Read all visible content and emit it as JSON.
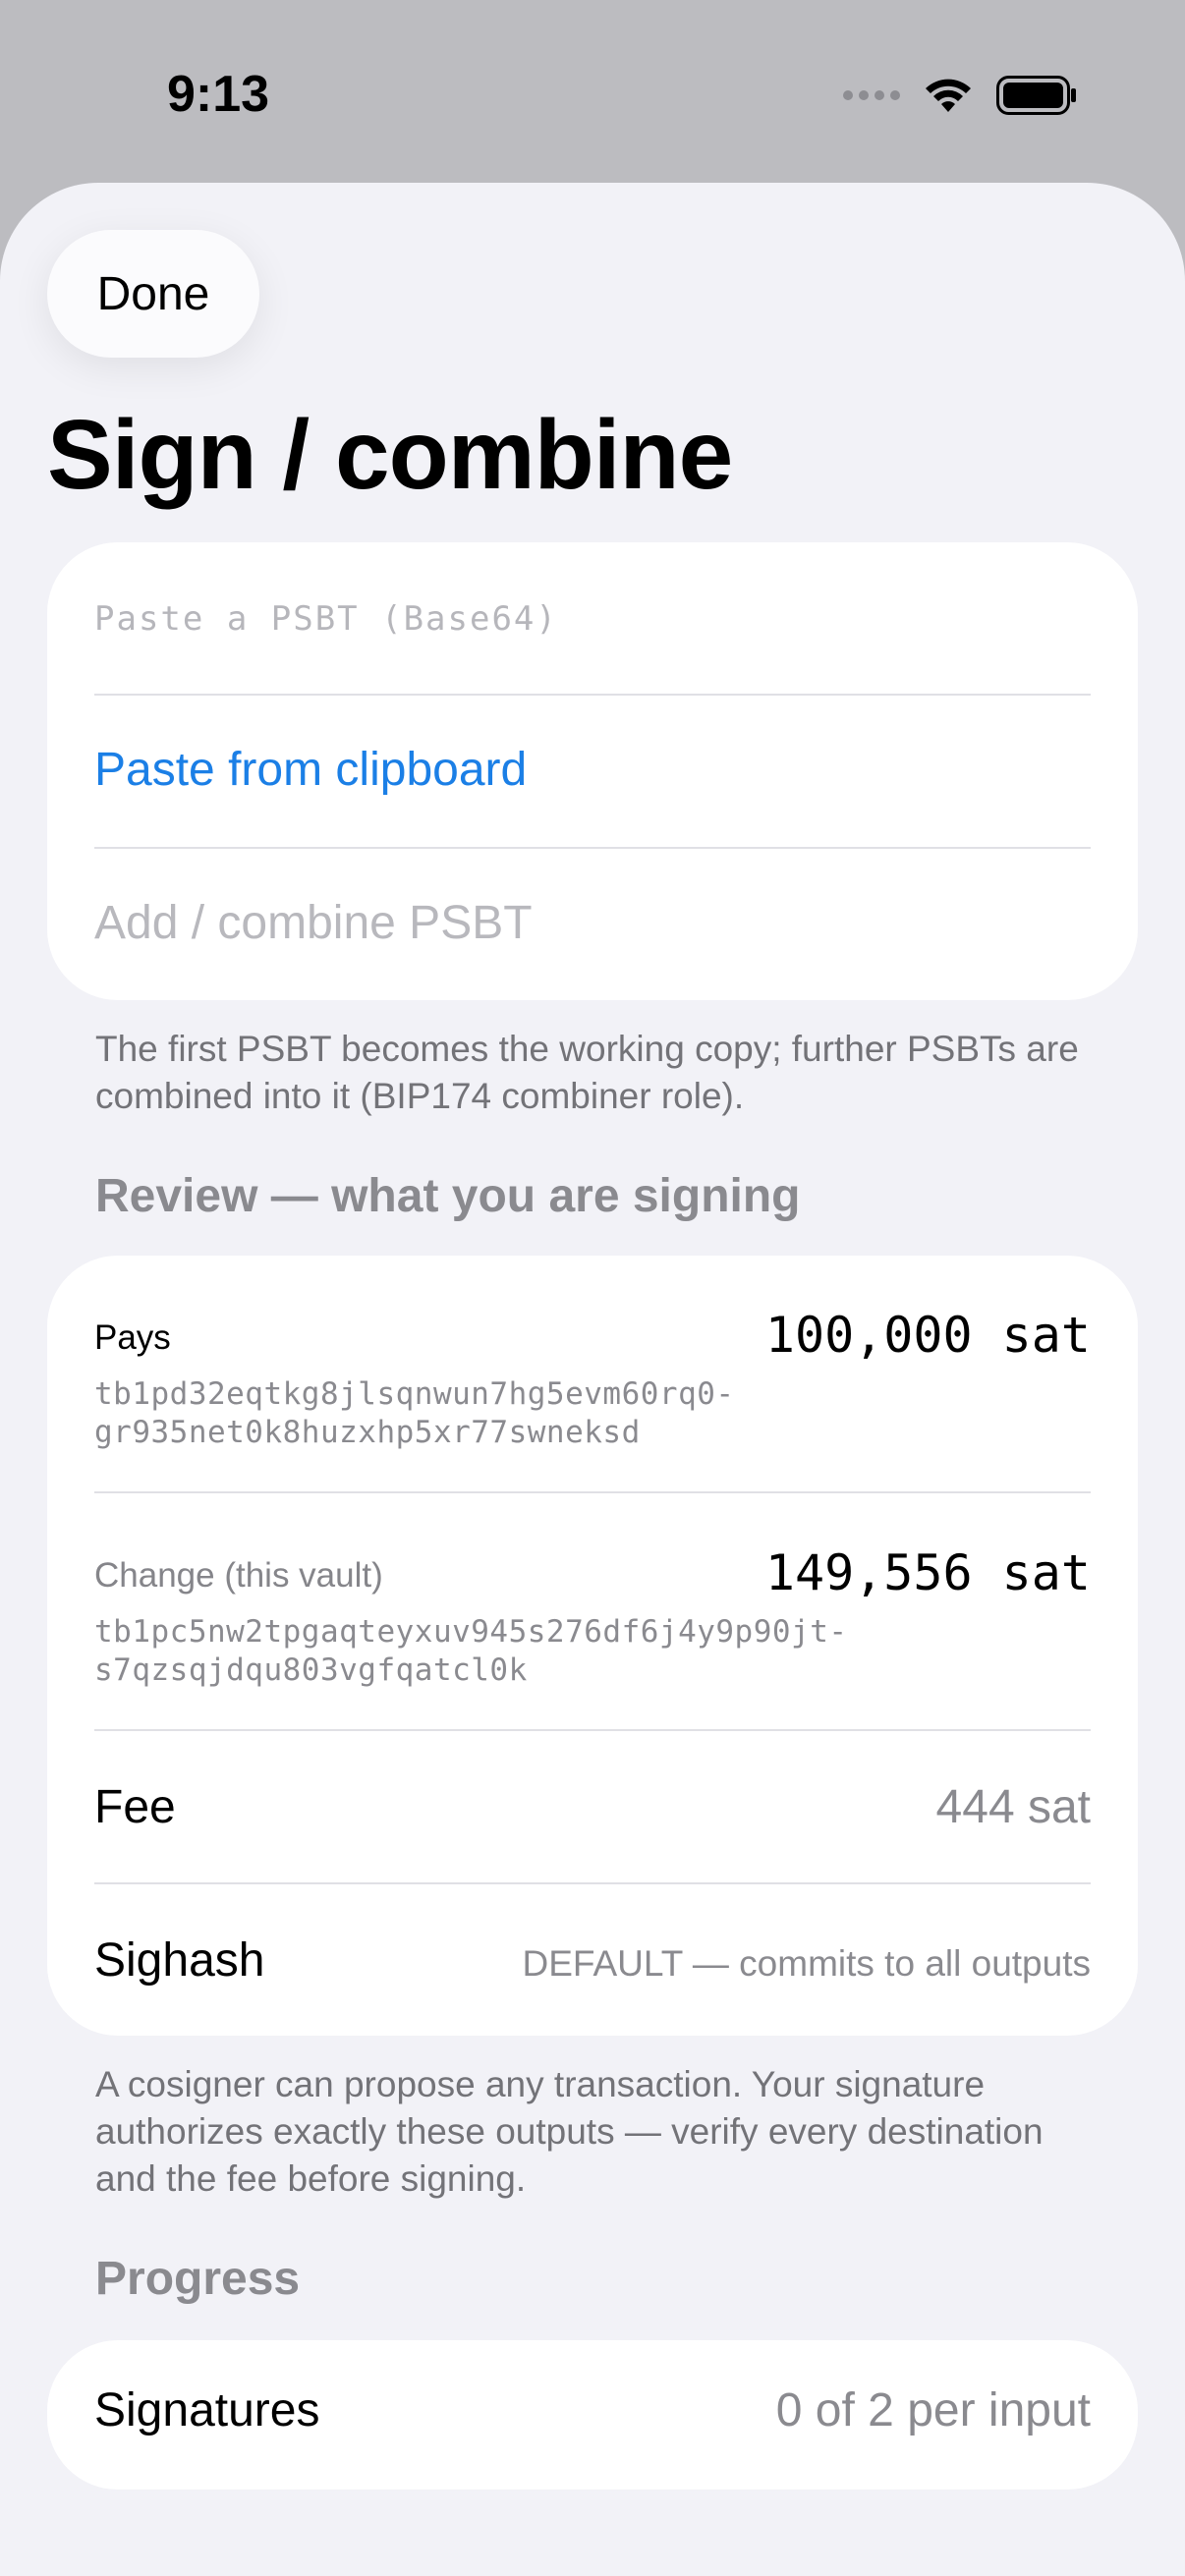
{
  "status_bar": {
    "time": "9:13"
  },
  "nav": {
    "done_label": "Done"
  },
  "page_title": "Sign / combine",
  "input_card": {
    "psbt_placeholder": "Paste a PSBT (Base64)",
    "paste_label": "Paste from clipboard",
    "add_label": "Add / combine PSBT"
  },
  "input_footer": "The first PSBT becomes the working copy; further PSBTs are combined into it (BIP174 combiner role).",
  "review": {
    "section_title": "Review — what you are signing",
    "pays": {
      "label": "Pays",
      "amount": "100,000 sat",
      "address_line1": "tb1pd32eqtkg8jlsqnwun7hg5evm60rq0-",
      "address_line2": "gr935net0k8huzxhp5xr77swneksd"
    },
    "change": {
      "label": "Change (this vault)",
      "amount": "149,556 sat",
      "address_line1": "tb1pc5nw2tpgaqteyxuv945s276df6j4y9p90jt-",
      "address_line2": "s7qzsqjdqu803vgfqatcl0k"
    },
    "fee": {
      "label": "Fee",
      "value": "444 sat"
    },
    "sighash": {
      "label": "Sighash",
      "value": "DEFAULT — commits to all outputs"
    },
    "footer": "A cosigner can propose any transaction. Your signature authorizes exactly these outputs — verify every destination and the fee before signing."
  },
  "progress": {
    "section_title": "Progress",
    "signatures_label": "Signatures",
    "signatures_value": "0 of 2 per input"
  },
  "colors": {
    "accent": "#1b7fe6",
    "background": "#f2f2f7",
    "card": "#ffffff"
  }
}
